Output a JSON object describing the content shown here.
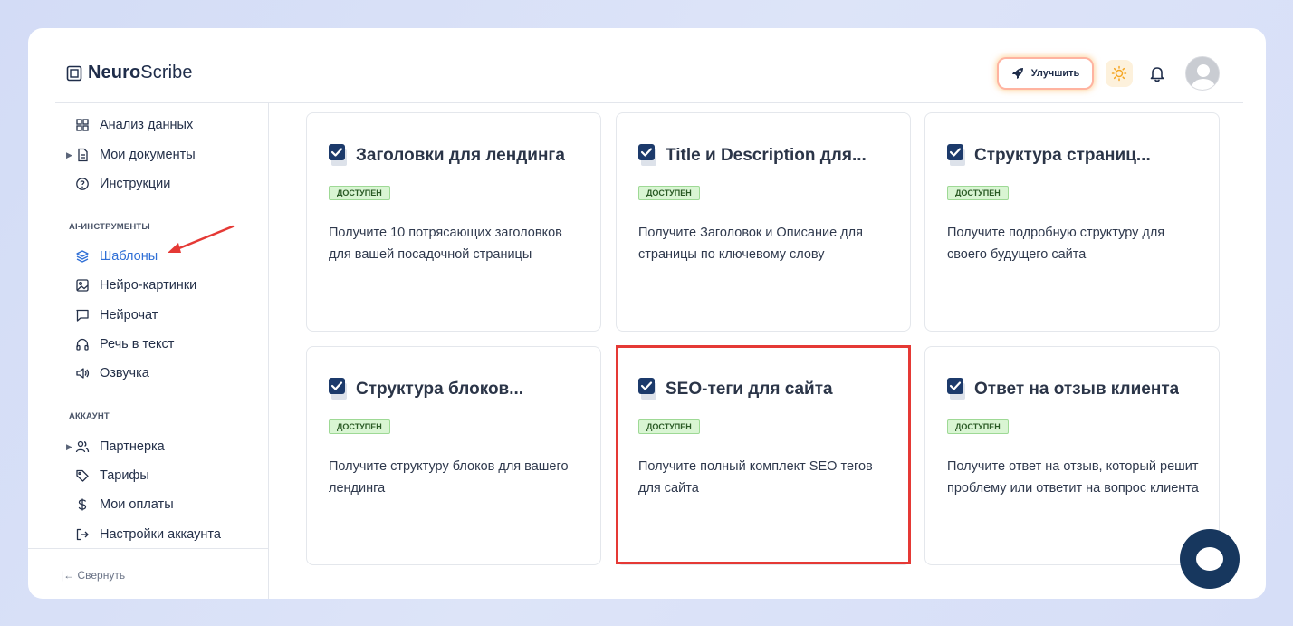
{
  "app": {
    "logo_bold": "Neuro",
    "logo_light": "Scribe"
  },
  "header": {
    "upgrade_label": "Улучшить",
    "theme_icon": "sun-icon",
    "bell_icon": "bell-icon",
    "avatar_icon": "user-avatar"
  },
  "sidebar": {
    "items_top": [
      {
        "label": "Анализ данных",
        "icon": "grid-icon"
      },
      {
        "label": "Мои документы",
        "icon": "document-icon"
      },
      {
        "label": "Инструкции",
        "icon": "help-icon"
      }
    ],
    "section_ai": "AI-ИНСТРУМЕНТЫ",
    "items_ai": [
      {
        "label": "Шаблоны",
        "icon": "layers-icon"
      },
      {
        "label": "Нейро-картинки",
        "icon": "image-icon"
      },
      {
        "label": "Нейрочат",
        "icon": "chat-icon"
      },
      {
        "label": "Речь в текст",
        "icon": "headphones-icon"
      },
      {
        "label": "Озвучка",
        "icon": "speaker-icon"
      }
    ],
    "section_account": "АККАУНТ",
    "items_account": [
      {
        "label": "Партнерка",
        "icon": "users-icon"
      },
      {
        "label": "Тарифы",
        "icon": "tag-icon"
      },
      {
        "label": "Мои оплаты",
        "icon": "dollar-icon"
      },
      {
        "label": "Настройки аккаунта",
        "icon": "logout-icon"
      }
    ],
    "collapse_label": "Свернуть"
  },
  "cards": [
    {
      "title": "Заголовки для лендинга",
      "badge": "ДОСТУПЕН",
      "desc": "Получите 10 потрясающих заголовков для вашей посадочной страницы"
    },
    {
      "title": "Title и Description для...",
      "badge": "ДОСТУПЕН",
      "desc": "Получите Заголовок и Описание для страницы по ключевому слову"
    },
    {
      "title": "Структура страниц...",
      "badge": "ДОСТУПЕН",
      "desc": "Получите подробную структуру для своего будущего сайта"
    },
    {
      "title": "Структура блоков...",
      "badge": "ДОСТУПЕН",
      "desc": "Получите структуру блоков для вашего лендинга"
    },
    {
      "title": "SEO-теги для сайта",
      "badge": "ДОСТУПЕН",
      "desc": "Получите полный комплект SEO тегов для сайта"
    },
    {
      "title": "Ответ на отзыв клиента",
      "badge": "ДОСТУПЕН",
      "desc": "Получите ответ на отзыв, который решит проблему или ответит на вопрос клиента"
    }
  ],
  "colors": {
    "accent": "#2f6fd6",
    "highlight": "#e53935",
    "badge_bg": "#d9f5d3",
    "chat_button": "#17375e"
  }
}
